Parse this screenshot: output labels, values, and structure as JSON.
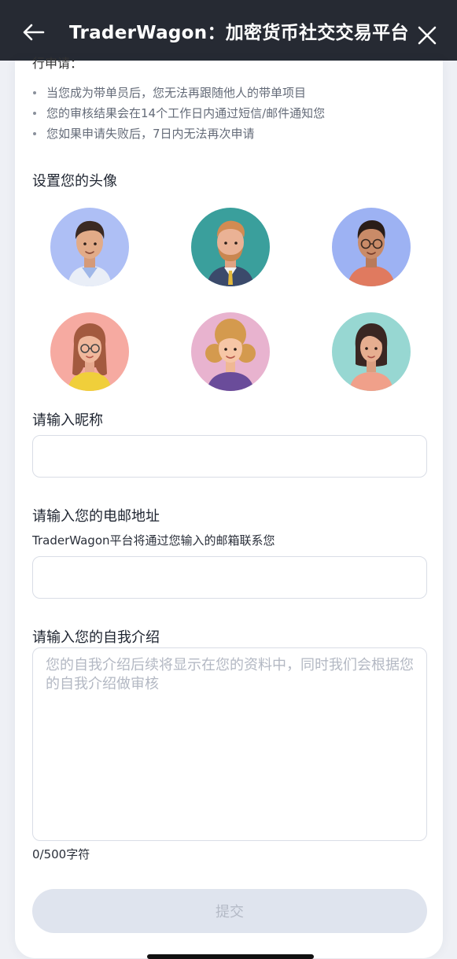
{
  "header": {
    "title": "TraderWagon：加密货币社交交易平台",
    "back_icon": "arrow-left-icon",
    "close_icon": "close-icon"
  },
  "application": {
    "cut_heading": "行申请："
  },
  "notes": [
    "当您成为带单员后，您无法再跟随他人的带单项目",
    "您的审核结果会在14个工作日内通过短信/邮件通知您",
    "您如果申请失败后，7日内无法再次申请"
  ],
  "avatar_section": {
    "label": "设置您的头像",
    "avatars": [
      {
        "name": "man-short-hair",
        "bg": "#aebff5"
      },
      {
        "name": "man-beard",
        "bg": "#3a9f9c"
      },
      {
        "name": "man-glasses",
        "bg": "#9db2f3"
      },
      {
        "name": "woman-glasses",
        "bg": "#f6aaa1"
      },
      {
        "name": "woman-curly",
        "bg": "#e8b3cf"
      },
      {
        "name": "woman-bob",
        "bg": "#97d7d2"
      }
    ]
  },
  "nickname": {
    "label": "请输入昵称",
    "value": "",
    "placeholder": ""
  },
  "email": {
    "label": "请输入您的电邮地址",
    "hint": "TraderWagon平台将通过您输入的邮箱联系您",
    "value": "",
    "placeholder": ""
  },
  "intro": {
    "label": "请输入您的自我介绍",
    "placeholder": "您的自我介绍后续将显示在您的资料中，同时我们会根据您的自我介绍做审核",
    "counter": "0/500字符"
  },
  "submit": {
    "label": "提交"
  },
  "colors": {
    "topbar": "#262a33",
    "disabled_button": "#dfe4ee"
  }
}
